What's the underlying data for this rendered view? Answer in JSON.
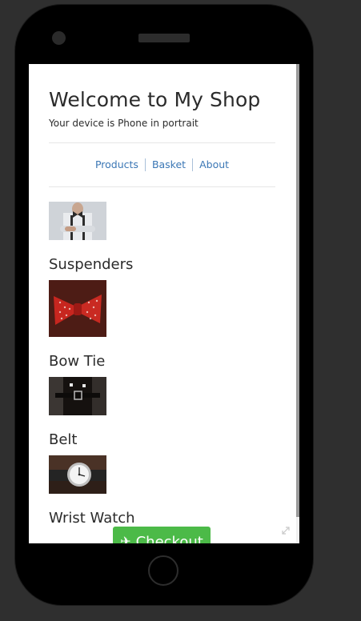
{
  "shop": {
    "title": "Welcome to My Shop",
    "device_text": "Your device is Phone in portrait"
  },
  "nav": {
    "items": [
      {
        "label": "Products"
      },
      {
        "label": "Basket"
      },
      {
        "label": "About"
      }
    ]
  },
  "products": [
    {
      "name": "Suspenders",
      "image_icon": "suspenders-photo"
    },
    {
      "name": "Bow Tie",
      "image_icon": "bow-tie-photo"
    },
    {
      "name": "Belt",
      "image_icon": "belt-photo"
    },
    {
      "name": "Wrist Watch",
      "image_icon": "wrist-watch-photo"
    }
  ],
  "checkout": {
    "label": "Checkout",
    "icon": "airplane-icon",
    "color": "#4cba48"
  },
  "colors": {
    "link": "#3b77b5",
    "text": "#2b2b2b",
    "device_frame": "#000000",
    "background": "#2f2f2f"
  }
}
